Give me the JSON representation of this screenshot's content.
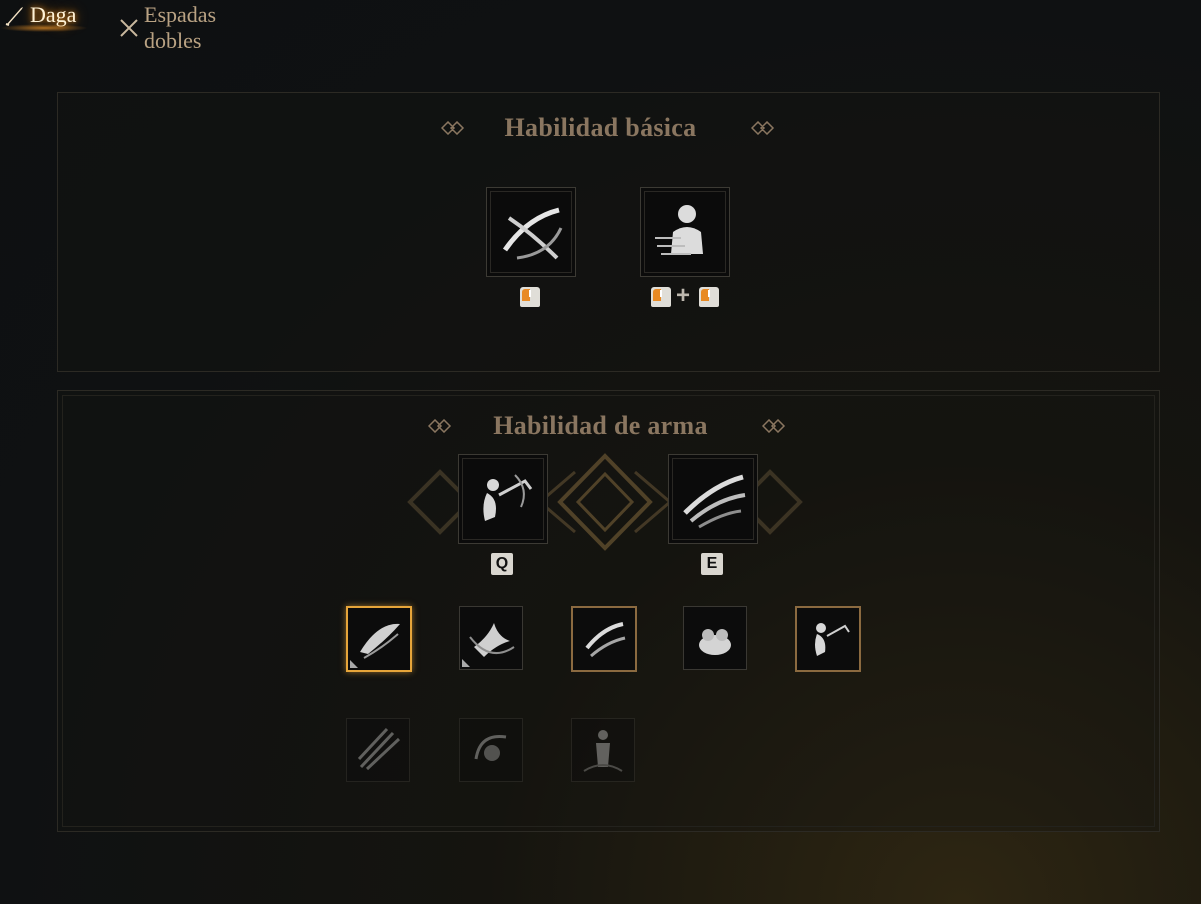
{
  "tabs": [
    {
      "label": "Daga",
      "icon": "dagger-icon",
      "active": true
    },
    {
      "label": "Espadas dobles",
      "icon": "crossed-swords-icon",
      "active": false
    }
  ],
  "basic": {
    "title": "Habilidad básica",
    "skills": [
      {
        "icon": "slash-strike-icon",
        "binding": "left-mouse"
      },
      {
        "icon": "silhouette-dash-icon",
        "binding": "left-mouse + left-mouse",
        "plus": "+"
      }
    ]
  },
  "weapon": {
    "title": "Habilidad de arma",
    "active_skills": [
      {
        "icon": "leaping-figure-icon",
        "key": "Q"
      },
      {
        "icon": "claw-slash-icon",
        "key": "E"
      }
    ],
    "passives_row1": [
      {
        "icon": "blade-swirl-icon",
        "state": "selected"
      },
      {
        "icon": "bird-strike-icon",
        "state": "available"
      },
      {
        "icon": "double-slash-icon",
        "state": "owned"
      },
      {
        "icon": "creature-icon",
        "state": "available"
      },
      {
        "icon": "leaping-figure-icon",
        "state": "owned"
      }
    ],
    "passives_row2": [
      {
        "icon": "multi-blade-icon",
        "state": "locked"
      },
      {
        "icon": "spin-figure-icon",
        "state": "locked"
      },
      {
        "icon": "standing-figure-icon",
        "state": "locked"
      }
    ]
  },
  "colors": {
    "accent": "#e6a53a",
    "title": "#8a7660",
    "tab_active_glow": "#e08a1e"
  }
}
